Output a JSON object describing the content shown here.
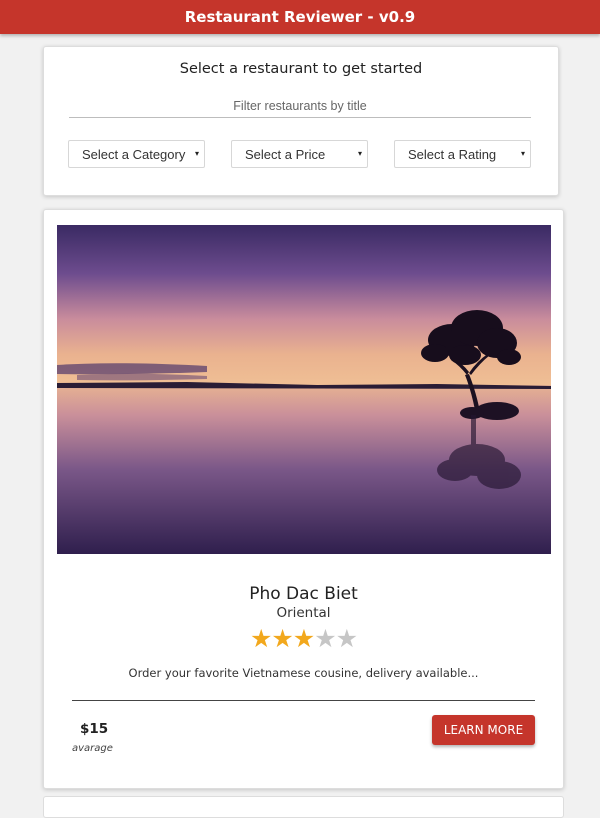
{
  "header": {
    "title": "Restaurant Reviewer - v0.9"
  },
  "filter": {
    "title": "Select a restaurant to get started",
    "placeholder": "Filter restaurants by title",
    "category_label": "Select a Category",
    "price_label": "Select a Price",
    "rating_label": "Select a Rating"
  },
  "restaurant": {
    "name": "Pho Dac Biet",
    "category": "Oriental",
    "rating": 3,
    "rating_max": 5,
    "description": "Order your favorite Vietnamese cousine, delivery available...",
    "price": "$15",
    "price_sub": "avarage",
    "button_label": "LEARN MORE"
  },
  "colors": {
    "accent": "#c5352b",
    "star": "#f2a81d",
    "star_empty": "#c6c6c6"
  },
  "icons": {
    "select_arrow": "▾",
    "star": "★"
  }
}
